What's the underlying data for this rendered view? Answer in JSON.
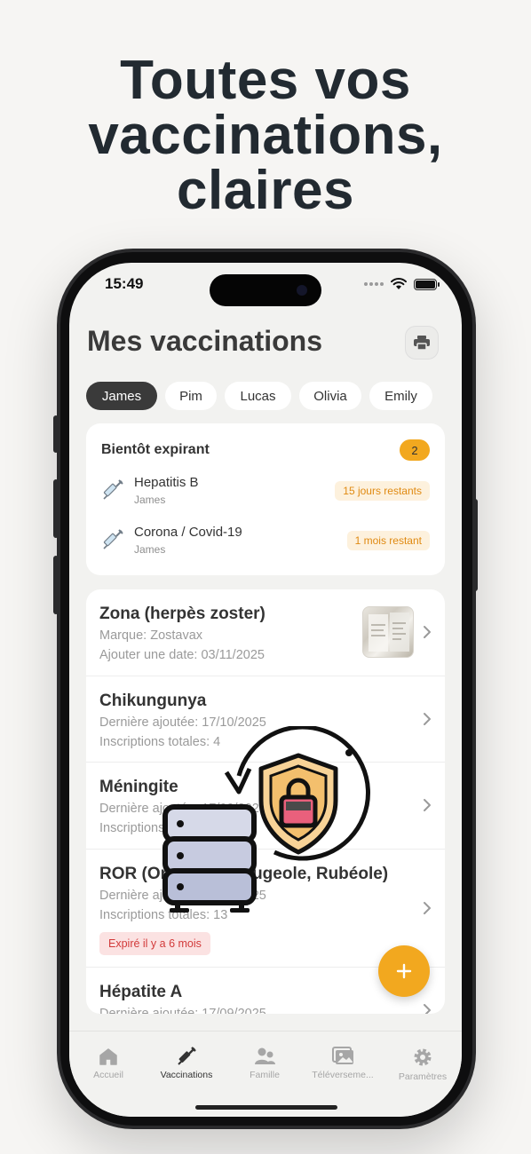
{
  "headline": [
    "Toutes vos",
    "vaccinations,",
    "claires"
  ],
  "status_bar": {
    "time": "15:49"
  },
  "screen_title": "Mes vaccinations",
  "people": [
    "James",
    "Pim",
    "Lucas",
    "Olivia",
    "Emily"
  ],
  "selected_person": "James",
  "expiring": {
    "title": "Bientôt expirant",
    "count": "2",
    "items": [
      {
        "name": "Hepatitis B",
        "person": "James",
        "remaining": "15 jours restants"
      },
      {
        "name": "Corona / Covid-19",
        "person": "James",
        "remaining": "1 mois restant"
      }
    ]
  },
  "vaccines": [
    {
      "title": "Zona (herpès zoster)",
      "line1": "Marque: Zostavax",
      "line2": "Ajouter une date: 03/11/2025",
      "has_photo": true
    },
    {
      "title": "Chikungunya",
      "line1": "Dernière ajoutée: 17/10/2025",
      "line2": "Inscriptions totales: 4"
    },
    {
      "title": "Méningite",
      "line1": "Dernière ajoutée: 17/09/2025",
      "line2": "Inscriptions totales: 2"
    },
    {
      "title": "ROR (Oreillons, Rougeole, Rubéole)",
      "line1": "Dernière ajoutée: 17/09/2025",
      "line2": "Inscriptions totales: 13",
      "badge": "Expiré il y a 6 mois"
    },
    {
      "title": "Hépatite A",
      "line1": "Dernière ajoutée: 17/09/2025"
    }
  ],
  "fab_symbol": "+",
  "tabs": [
    {
      "label": "Accueil",
      "icon": "home-icon"
    },
    {
      "label": "Vaccinations",
      "icon": "syringe-icon",
      "active": true
    },
    {
      "label": "Famille",
      "icon": "family-icon"
    },
    {
      "label": "Téléverseme...",
      "icon": "photos-icon"
    },
    {
      "label": "Paramètres",
      "icon": "gear-icon"
    }
  ],
  "colors": {
    "accent": "#f2a81f",
    "dark_chip": "#3a3a3a",
    "expired_text": "#d23a3a",
    "warning_text": "#e08a12"
  }
}
